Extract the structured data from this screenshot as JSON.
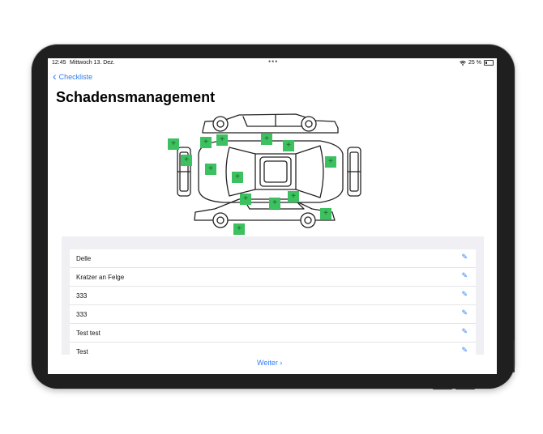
{
  "status_bar": {
    "time": "12:45",
    "date": "Mittwoch 13. Dez.",
    "dots": "•••",
    "battery": "25 %"
  },
  "nav": {
    "back_label": "Checkliste",
    "back_chevron": "‹"
  },
  "page": {
    "title": "Schadensmanagement"
  },
  "diagram": {
    "marker_symbol": "+",
    "marker_color": "#3cc060",
    "marker_count": 15
  },
  "damages": [
    {
      "label": "Delle"
    },
    {
      "label": "Kratzer an Felge"
    },
    {
      "label": "333"
    },
    {
      "label": "333"
    },
    {
      "label": "Test test"
    },
    {
      "label": "Test"
    }
  ],
  "edit_icon": "pencil-icon",
  "footer": {
    "next_label": "Weiter",
    "next_chevron": "›"
  },
  "colors": {
    "accent": "#2d7cf6",
    "marker": "#3cc060",
    "panel_bg": "#efeff4"
  }
}
